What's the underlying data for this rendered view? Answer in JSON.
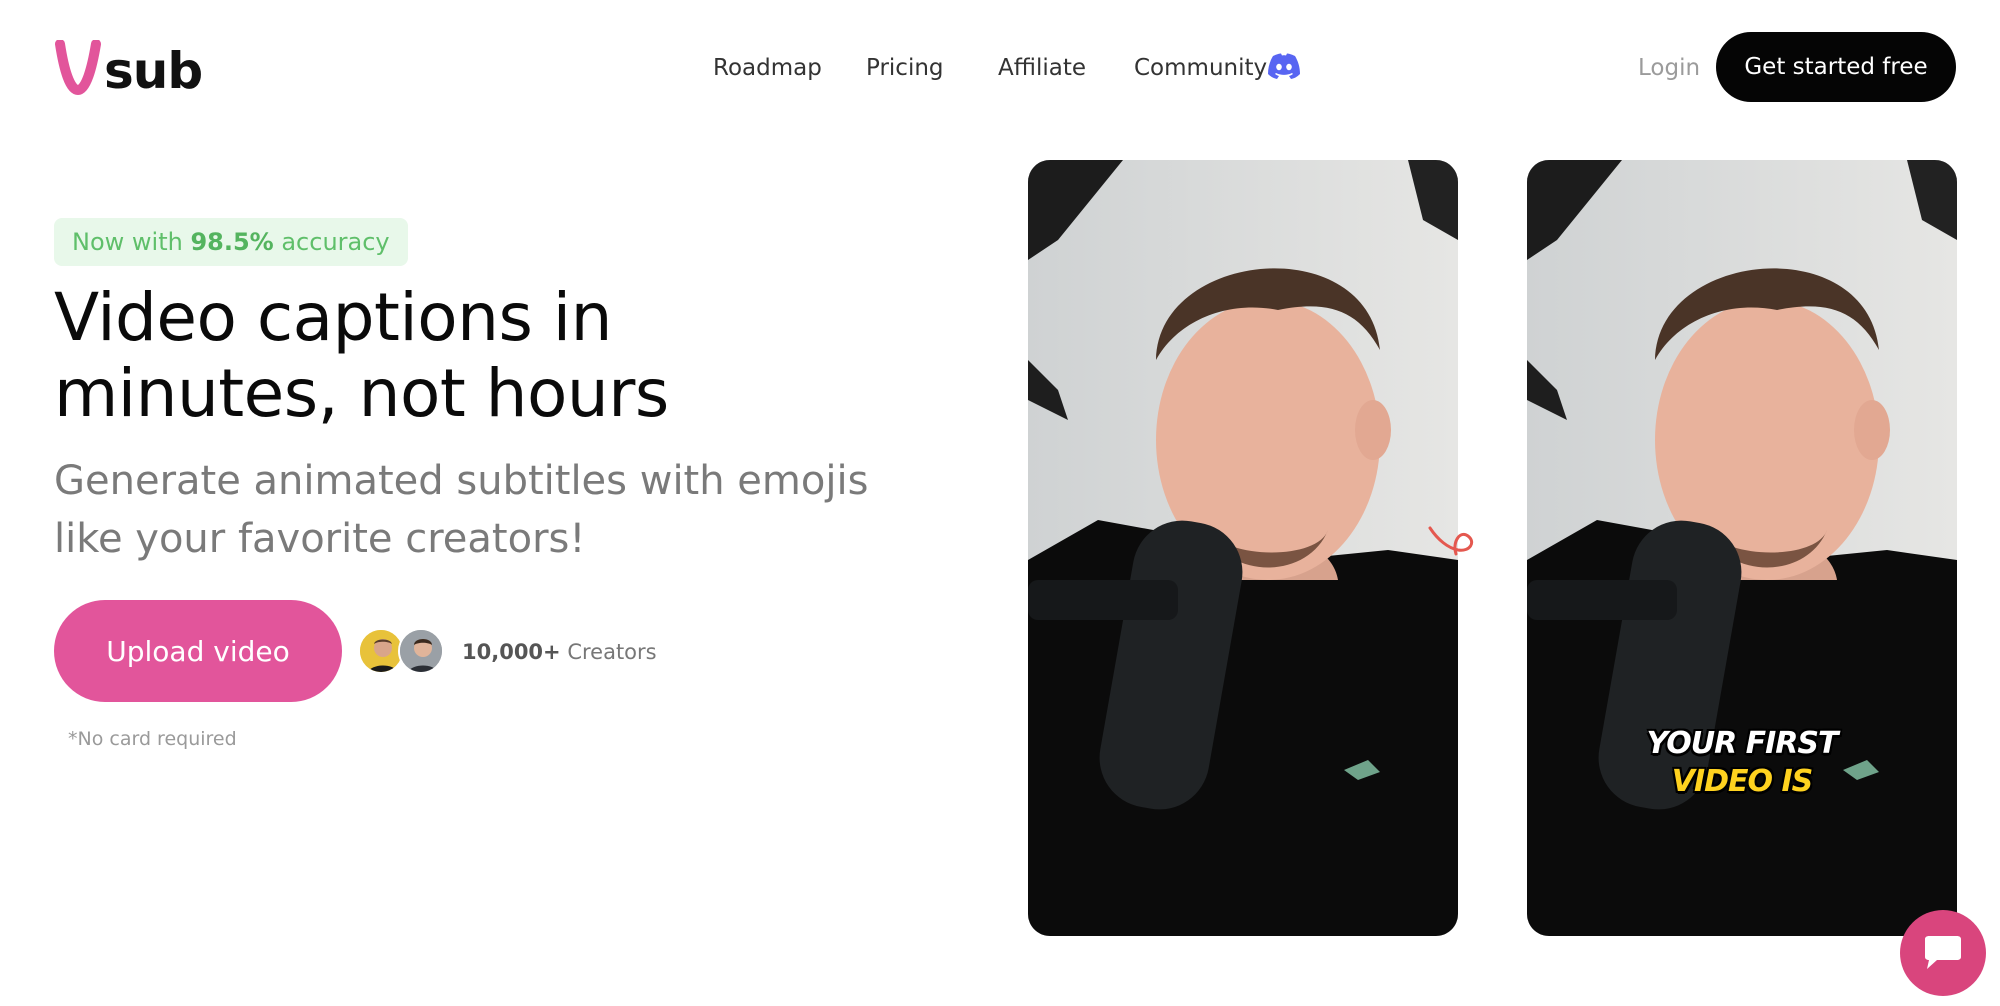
{
  "brand": {
    "logo_text": "sub",
    "accent": "#e2559b"
  },
  "nav": {
    "items": [
      {
        "label": "Roadmap"
      },
      {
        "label": "Pricing"
      },
      {
        "label": "Affiliate"
      },
      {
        "label": "Community"
      }
    ],
    "login_label": "Login",
    "cta_label": "Get started free"
  },
  "hero": {
    "badge_prefix": "Now with ",
    "badge_value": "98.5%",
    "badge_suffix": " accuracy",
    "title_line1": "Video captions in",
    "title_line2": "minutes, not hours",
    "subtitle_line1": "Generate animated subtitles with emojis",
    "subtitle_line2": "like your favorite creators!",
    "upload_label": "Upload video",
    "creators_count": "10,000+",
    "creators_label": " Creators",
    "no_card": "*No card required"
  },
  "preview": {
    "caption_line1": "YOUR FIRST",
    "caption_line2": "VIDEO IS",
    "caption_color1": "#ffffff",
    "caption_color2": "#ffd21f"
  },
  "icons": {
    "discord": "discord-icon",
    "arrow": "curly-arrow-icon",
    "chat": "chat-bubble-icon"
  }
}
